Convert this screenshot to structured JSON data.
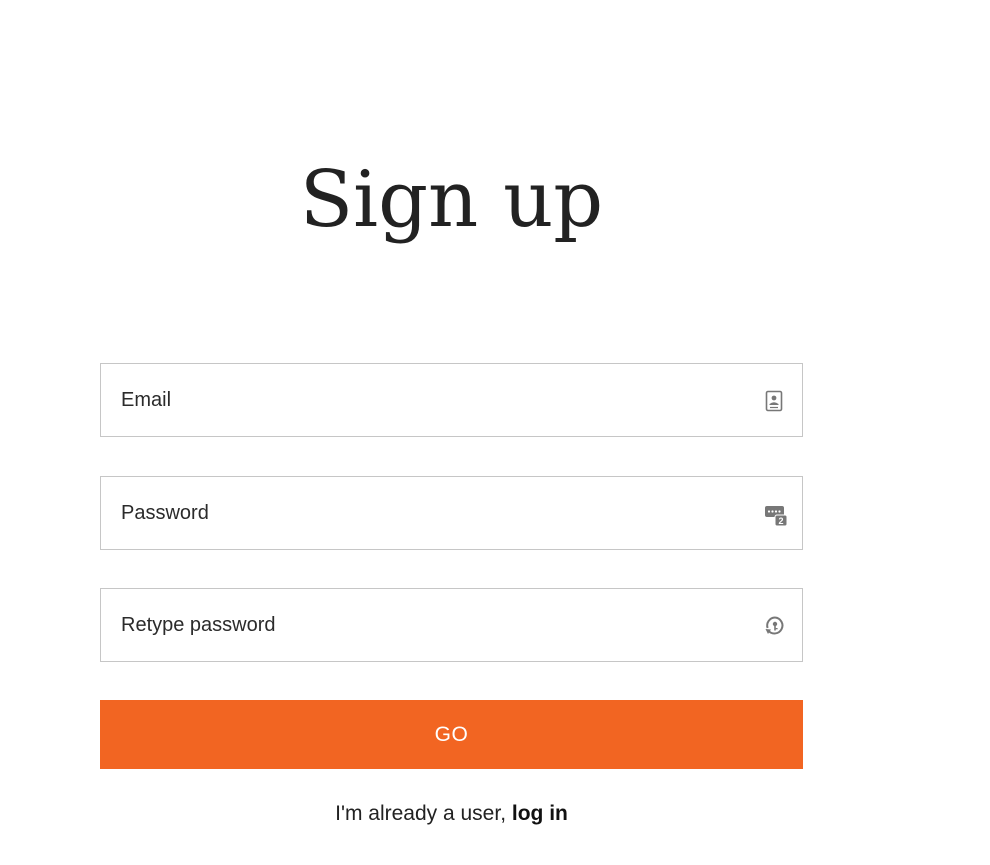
{
  "page": {
    "title": "Sign up"
  },
  "form": {
    "email": {
      "placeholder": "Email",
      "value": "",
      "icon": "contact-card-icon"
    },
    "password": {
      "placeholder": "Password",
      "value": "",
      "icon": "password-keyboard-icon"
    },
    "retype_password": {
      "placeholder": "Retype password",
      "value": "",
      "icon": "key-refresh-icon"
    },
    "submit_label": "GO"
  },
  "footer": {
    "prompt": "I'm already a user, ",
    "login_link": "log in"
  },
  "colors": {
    "accent": "#f26522",
    "border": "#c6c6c6",
    "text": "#222222"
  }
}
